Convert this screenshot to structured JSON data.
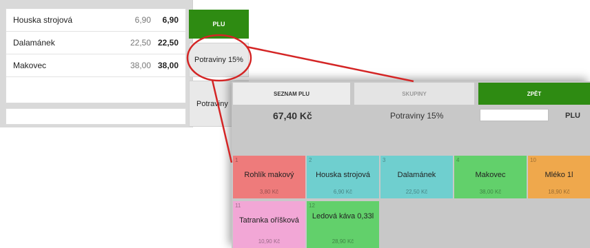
{
  "receipt": {
    "items": [
      {
        "name": "Houska strojová",
        "unit_price": "6,90",
        "total": "6,90"
      },
      {
        "name": "Dalamánek",
        "unit_price": "22,50",
        "total": "22,50"
      },
      {
        "name": "Makovec",
        "unit_price": "38,00",
        "total": "38,00"
      }
    ]
  },
  "bg_buttons": {
    "plu": "PLU",
    "category_1": "Potraviny 15%",
    "category_2": "Potraviny"
  },
  "overlay": {
    "tabs": {
      "seznam": "SEZNAM PLU",
      "skupiny": "SKUPINY",
      "zpet": "ZPĚT"
    },
    "total_amount": "67,40 Kč",
    "group_name": "Potraviny 15%",
    "plu_label": "PLU",
    "tiles": [
      {
        "num": "1",
        "title": "Rohlík makový",
        "price": "3,80 Kč",
        "color": "#ee7b7b"
      },
      {
        "num": "2",
        "title": "Houska strojová",
        "price": "6,90 Kč",
        "color": "#6fcfcf"
      },
      {
        "num": "3",
        "title": "Dalamánek",
        "price": "22,50 Kč",
        "color": "#6fcfcf"
      },
      {
        "num": "4",
        "title": "Makovec",
        "price": "38,00 Kč",
        "color": "#62d06b"
      },
      {
        "num": "10",
        "title": "Mléko 1l",
        "price": "18,90 Kč",
        "color": "#efa84c"
      },
      {
        "num": "11",
        "title": "Tatranka oříšková",
        "price": "10,90 Kč",
        "color": "#f2a7d6"
      },
      {
        "num": "12",
        "title": "Ledová káva 0,33l",
        "price": "28,90 Kč",
        "color": "#62d06b"
      }
    ]
  },
  "colors": {
    "accent_green": "#2e8b12",
    "callout_red": "#d42525"
  }
}
